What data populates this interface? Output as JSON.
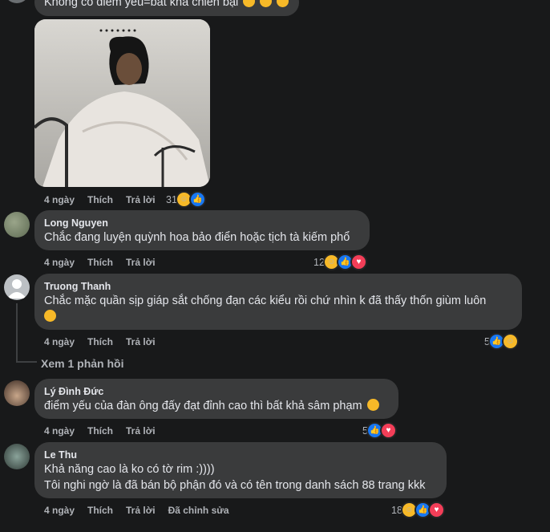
{
  "top_comment": {
    "text": "Không có điểm yếu=bất khả chiến bại"
  },
  "image_comment": {
    "meta": {
      "time": "4 ngày",
      "like": "Thích",
      "reply": "Trả lời"
    },
    "reaction_count": "31",
    "reaction_icons": [
      "haha-icon",
      "like-icon"
    ]
  },
  "comments": [
    {
      "author": "Long Nguyen",
      "lines": [
        "Chắc đang luyện quỳnh hoa bảo điển hoặc tịch tà kiếm phổ"
      ],
      "meta": {
        "time": "4 ngày",
        "like": "Thích",
        "reply": "Trả lời"
      },
      "reaction_count": "12"
    },
    {
      "author": "Truong Thanh",
      "lines": [
        "Chắc mặc quần sịp giáp sắt chống đạn các kiểu rồi chứ nhìn k đã thấy thốn giùm luôn"
      ],
      "meta": {
        "time": "4 ngày",
        "like": "Thích",
        "reply": "Trả lời"
      },
      "reaction_count": "5",
      "view_replies": "Xem 1 phản hồi"
    },
    {
      "author": "Lý Đình Đức",
      "lines": [
        "điểm yếu của đàn ông đấy đạt đỉnh cao thì bất khả sâm phạm"
      ],
      "meta": {
        "time": "4 ngày",
        "like": "Thích",
        "reply": "Trả lời"
      },
      "reaction_count": "5"
    },
    {
      "author": "Le Thu",
      "lines": [
        "Khả năng cao là ko có tờ rim :))))",
        "Tôi nghi ngờ là đã bán bộ phận đó và có tên trong danh sách 88 trang kkk"
      ],
      "meta": {
        "time": "4 ngày",
        "like": "Thích",
        "reply": "Trả lời",
        "edited": "Đã chỉnh sửa"
      },
      "reaction_count": "18"
    }
  ],
  "colors": {
    "background": "#18191a",
    "bubble": "#3a3b3c",
    "like": "#1877f2",
    "love": "#f33e58",
    "haha": "#f7b928"
  }
}
